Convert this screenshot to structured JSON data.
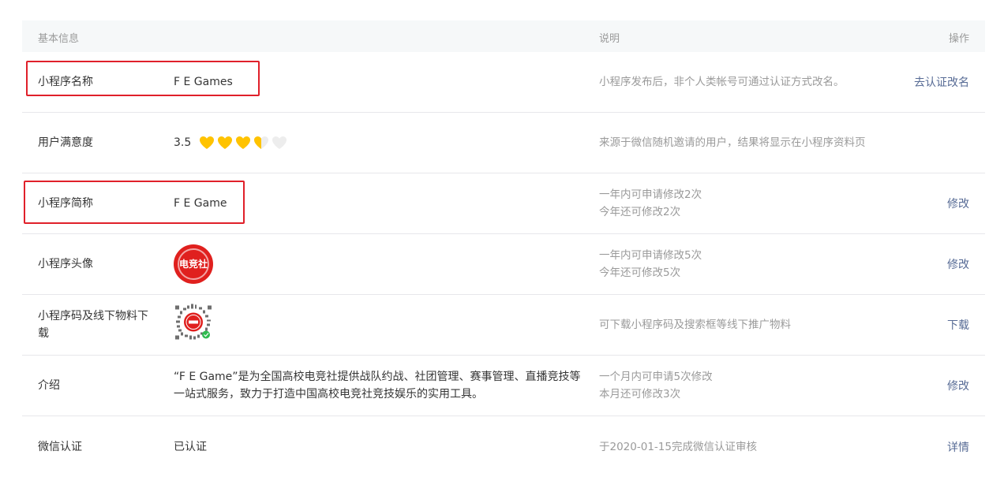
{
  "header": {
    "info": "基本信息",
    "desc": "说明",
    "op": "操作"
  },
  "rows": [
    {
      "label": "小程序名称",
      "value": "F E Games",
      "desc": "小程序发布后，非个人类帐号可通过认证方式改名。",
      "op": "去认证改名"
    },
    {
      "label": "用户满意度",
      "value": "3.5",
      "desc": "来源于微信随机邀请的用户，结果将显示在小程序资料页",
      "op": ""
    },
    {
      "label": "小程序简称",
      "value": "F E Game",
      "desc1": "一年内可申请修改2次",
      "desc2": "今年还可修改2次",
      "op": "修改"
    },
    {
      "label": "小程序头像",
      "avatar_text": "电竞社",
      "desc1": "一年内可申请修改5次",
      "desc2": "今年还可修改5次",
      "op": "修改"
    },
    {
      "label": "小程序码及线下物料下载",
      "desc": "可下载小程序码及搜索框等线下推广物料",
      "op": "下载"
    },
    {
      "label": "介绍",
      "value": "“F E Game”是为全国高校电竞社提供战队约战、社团管理、赛事管理、直播竞技等一站式服务，致力于打造中国高校电竞社竞技娱乐的实用工具。",
      "desc1": "一个月内可申请5次修改",
      "desc2": "本月还可修改3次",
      "op": "修改"
    },
    {
      "label": "微信认证",
      "value": "已认证",
      "desc": "于2020-01-15完成微信认证审核",
      "op": "详情"
    }
  ],
  "rating": {
    "value": 3.5,
    "max": 5
  },
  "colors": {
    "link": "#576b95",
    "highlight": "#e0202a",
    "heart": "#ffc300",
    "heart_empty": "#ededed"
  }
}
